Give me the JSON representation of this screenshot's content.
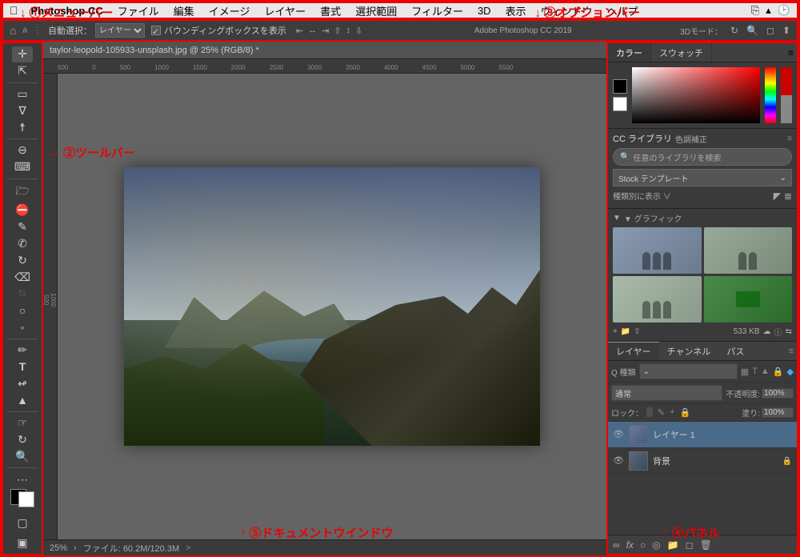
{
  "annotations": {
    "menubar_label": "①メニューバー",
    "optionsbar_label": "③オプションバー",
    "toolbar_label": "②ツールバー",
    "docwindow_label": "⑤ドキュメントウインドウ",
    "panel_label": "④パネル"
  },
  "menubar": {
    "app_name": "Photoshop CC",
    "items": [
      "ファイル",
      "編集",
      "イメージ",
      "レイヤー",
      "書式",
      "選択範囲",
      "フィルター",
      "3D",
      "表示",
      "ウィンドウ",
      "ヘルプ"
    ]
  },
  "optionsbar": {
    "tool_label": "自動選択：",
    "tool_select": "レイヤー",
    "checkbox_label": "バウンディングボックスを表示",
    "app_version": "Adobe Photoshop CC 2019",
    "mode_label": "3Dモード："
  },
  "document": {
    "tab_title": "taylor-leopold-105933-unsplash.jpg @ 25% (RGB/8) *"
  },
  "toolbar": {
    "tools": [
      "✛",
      "↖",
      "⬚",
      "◯",
      "✒",
      "✏",
      "⌫",
      "◈",
      "T",
      "⌖",
      "↗",
      "⬜",
      "◉",
      "🔍",
      "⋯"
    ]
  },
  "statusbar": {
    "zoom": "25%",
    "file_info": "ファイル: 60.2M/120.3M",
    "arrow": "›"
  },
  "right_panel": {
    "color_tab": "カラー",
    "swatches_tab": "スウォッチ",
    "cc_library": {
      "title": "CC ライブラリ",
      "subtitle": "色調補正",
      "search_placeholder": "任意のライブラリを検索",
      "dropdown_label": "Stock テンプレート",
      "view_label": "種類別に表示 ∨",
      "graphic_label": "▼ グラフィック",
      "file_size": "533 KB"
    },
    "layers": {
      "tab1": "レイヤー",
      "tab2": "チャンネル",
      "tab3": "パス",
      "filter_label": "Q 種類",
      "blend_mode": "通常",
      "opacity_label": "不透明度:",
      "opacity_value": "100%",
      "lock_label": "ロック：",
      "fill_label": "塗り: 100%",
      "layer1_name": "レイヤー 1",
      "layer2_name": "背景"
    }
  }
}
